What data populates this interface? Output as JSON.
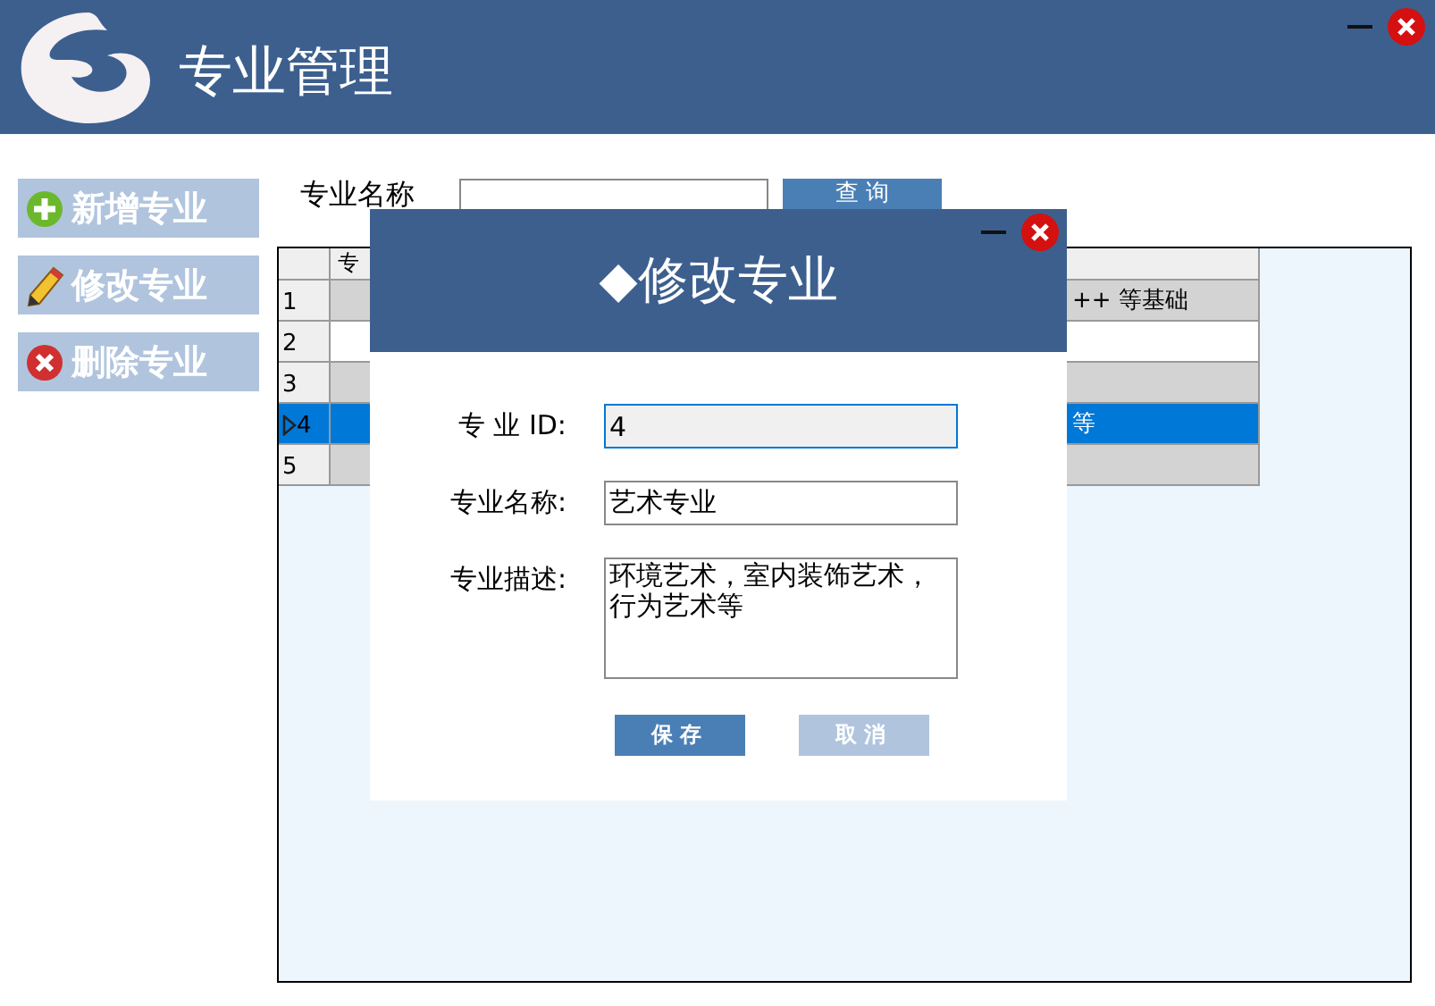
{
  "app": {
    "title": "专业管理"
  },
  "sidebar": {
    "buttons": [
      {
        "kind": "add",
        "label": "新增专业"
      },
      {
        "kind": "edit",
        "label": "修改专业"
      },
      {
        "kind": "delete",
        "label": "删除专业"
      }
    ]
  },
  "search": {
    "label": "专业名称",
    "button": "查 询"
  },
  "grid": {
    "column_1": "专",
    "rows": [
      {
        "number": "1",
        "column_2": "++ 等基础",
        "selected": false
      },
      {
        "number": "2",
        "selected": false
      },
      {
        "number": "3",
        "selected": false
      },
      {
        "number": "4",
        "column_2": "等",
        "selected": true
      },
      {
        "number": "5",
        "selected": false
      }
    ]
  },
  "dialog": {
    "title": "◆修改专业",
    "fields": [
      {
        "kind": "input",
        "label": "专 业 ID:",
        "value": "4",
        "readonly": true
      },
      {
        "kind": "input",
        "label": "专业名称:",
        "value": "艺术专业",
        "readonly": false
      },
      {
        "kind": "textarea",
        "label": "专业描述:",
        "value": "环境艺术，室内装饰艺术，行为艺术等",
        "readonly": false
      }
    ],
    "buttons": [
      {
        "label": "保存",
        "primary": true
      },
      {
        "label": "取消",
        "primary": false
      }
    ]
  }
}
